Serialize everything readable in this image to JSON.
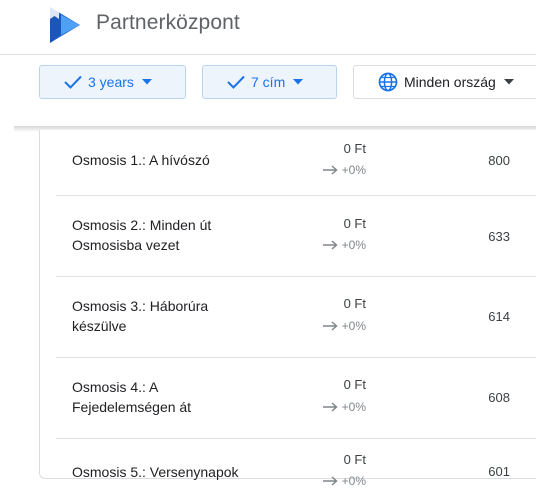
{
  "header": {
    "app_title": "Partnerközpont",
    "logo_icon": "google-play-books-logo",
    "logo_colors": {
      "dark": "#1a57b8",
      "mid": "#2f6fd6",
      "light": "#4ea0f5"
    }
  },
  "filters": {
    "period": {
      "label": "3 years",
      "icon": "check-icon"
    },
    "titles": {
      "label": "7 cím",
      "icon": "check-icon"
    },
    "country": {
      "label": "Minden ország",
      "icon": "globe-icon"
    }
  },
  "books": [
    {
      "title_line1": "Osmosis 1.: A hívószó",
      "title_line2": "",
      "revenue": "0 Ft",
      "change": "+0%",
      "count": "800"
    },
    {
      "title_line1": "Osmosis 2.: Minden út",
      "title_line2": "Osmosisba vezet",
      "revenue": "0 Ft",
      "change": "+0%",
      "count": "633"
    },
    {
      "title_line1": "Osmosis 3.: Háborúra",
      "title_line2": "készülve",
      "revenue": "0 Ft",
      "change": "+0%",
      "count": "614"
    },
    {
      "title_line1": "Osmosis 4.: A",
      "title_line2": "Fejedelemségen át",
      "revenue": "0 Ft",
      "change": "+0%",
      "count": "608"
    },
    {
      "title_line1": "Osmosis 5.: Versenynapok",
      "title_line2": "",
      "revenue": "0 Ft",
      "change": "+0%",
      "count": "601"
    }
  ],
  "colors": {
    "accent": "#1a73e8",
    "chip_bg": "#eef4fb",
    "muted": "#80868b"
  }
}
